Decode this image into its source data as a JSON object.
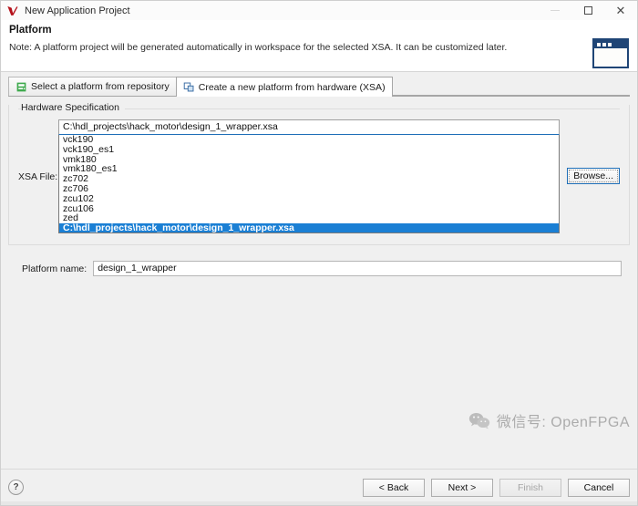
{
  "titlebar": {
    "title": "New Application Project",
    "app_icon": "vitis-logo-icon",
    "minimize": "minimize-icon",
    "maximize": "maximize-icon",
    "close": "close-icon"
  },
  "header": {
    "title": "Platform",
    "note": "Note: A platform project will be generated automatically in workspace for the selected XSA. It can be customized later.",
    "graphic": "wizard-window-graphic"
  },
  "tabs": [
    {
      "label": "Select a platform from repository",
      "icon": "repository-platform-icon",
      "active": false
    },
    {
      "label": "Create a new platform from hardware (XSA)",
      "icon": "hardware-xsa-icon",
      "active": true
    }
  ],
  "hardware_group": {
    "legend": "Hardware Specification",
    "xsa_file_label": "XSA File:",
    "combo_value": "C:\\hdl_projects\\hack_motor\\design_1_wrapper.xsa",
    "browse_label": "Browse...",
    "options": [
      {
        "label": "vck190",
        "selected": false
      },
      {
        "label": "vck190_es1",
        "selected": false
      },
      {
        "label": "vmk180",
        "selected": false
      },
      {
        "label": "vmk180_es1",
        "selected": false
      },
      {
        "label": "zc702",
        "selected": false
      },
      {
        "label": "zc706",
        "selected": false
      },
      {
        "label": "zcu102",
        "selected": false
      },
      {
        "label": "zcu106",
        "selected": false
      },
      {
        "label": "zed",
        "selected": false
      },
      {
        "label": "C:\\hdl_projects\\hack_motor\\design_1_wrapper.xsa",
        "selected": true
      }
    ]
  },
  "platform_name": {
    "label": "Platform name:",
    "value": "design_1_wrapper"
  },
  "watermark": {
    "text": "微信号: OpenFPGA",
    "logo": "wechat-logo-icon"
  },
  "footer": {
    "help": "?",
    "back": "< Back",
    "next": "Next >",
    "finish": "Finish",
    "cancel": "Cancel"
  },
  "colors": {
    "selection_blue": "#1a7fd4",
    "accent_dark_blue": "#1f4576",
    "tab_green": "#3faa4e",
    "logo_red": "#b5121b",
    "dialog_bg": "#f0f0f0"
  }
}
